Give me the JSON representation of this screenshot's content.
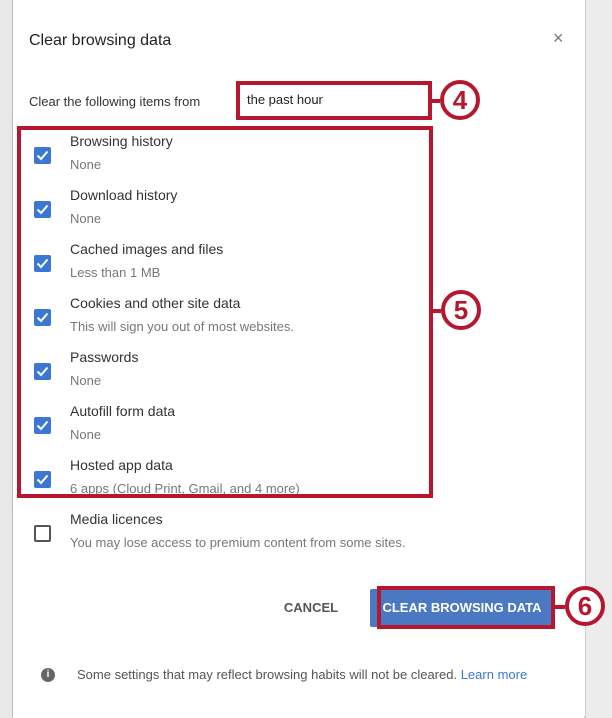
{
  "dialog": {
    "title": "Clear browsing data",
    "close_symbol": "×"
  },
  "time_range": {
    "label": "Clear the following items from",
    "value": "the past hour"
  },
  "items": [
    {
      "label": "Browsing history",
      "sub": "None",
      "checked": true
    },
    {
      "label": "Download history",
      "sub": "None",
      "checked": true
    },
    {
      "label": "Cached images and files",
      "sub": "Less than 1 MB",
      "checked": true
    },
    {
      "label": "Cookies and other site data",
      "sub": "This will sign you out of most websites.",
      "checked": true
    },
    {
      "label": "Passwords",
      "sub": "None",
      "checked": true
    },
    {
      "label": "Autofill form data",
      "sub": "None",
      "checked": true
    },
    {
      "label": "Hosted app data",
      "sub": "6 apps (Cloud Print, Gmail, and 4 more)",
      "checked": true
    },
    {
      "label": "Media licences",
      "sub": "You may lose access to premium content from some sites.",
      "checked": false
    }
  ],
  "buttons": {
    "cancel": "CANCEL",
    "clear": "CLEAR BROWSING DATA"
  },
  "footer": {
    "info_symbol": "i",
    "text": "Some settings that may reflect browsing habits will not be cleared.",
    "learn_more": "Learn more"
  },
  "callouts": {
    "four": "4",
    "five": "5",
    "six": "6"
  },
  "colors": {
    "accent": "#3b78d4",
    "button": "#4a78c2",
    "callout": "#b5172f"
  }
}
